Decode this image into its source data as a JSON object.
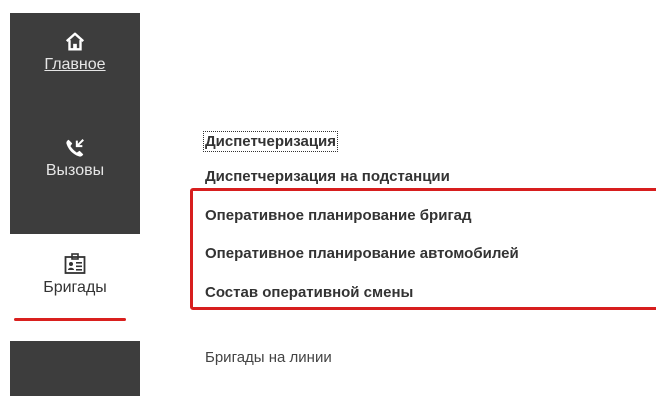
{
  "sidebar": {
    "items": [
      {
        "label": "Главное",
        "icon": "home-icon"
      },
      {
        "label": "Вызовы",
        "icon": "phone-call-icon"
      },
      {
        "label": "Бригады",
        "icon": "id-badge-icon",
        "active": true
      }
    ]
  },
  "main": {
    "links": [
      "Диспетчеризация",
      "Диспетчеризация на подстанции",
      "Оперативное планирование бригад",
      "Оперативное планирование автомобилей",
      "Состав оперативной смены"
    ],
    "secondary_links": [
      "Бригады на линии"
    ]
  },
  "colors": {
    "sidebar_bg": "#3d3d3d",
    "annotation_red": "#d71e1e"
  }
}
